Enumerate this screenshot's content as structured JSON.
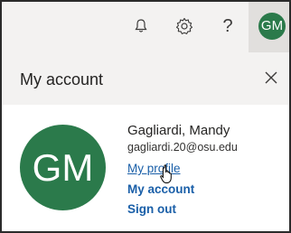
{
  "topbar": {
    "icons": [
      "bell-icon",
      "gear-icon",
      "help-icon"
    ],
    "help_glyph": "?",
    "avatar_initials": "GM"
  },
  "account_panel": {
    "title": "My account",
    "avatar_initials": "GM",
    "user_name": "Gagliardi, Mandy",
    "user_email": "gagliardi.20@osu.edu",
    "links": {
      "profile": "My profile",
      "account": "My account",
      "signout": "Sign out"
    }
  },
  "colors": {
    "avatar_bg": "#2b7a4b",
    "link": "#1a5fa8",
    "header_bg": "#f3f2f1"
  }
}
